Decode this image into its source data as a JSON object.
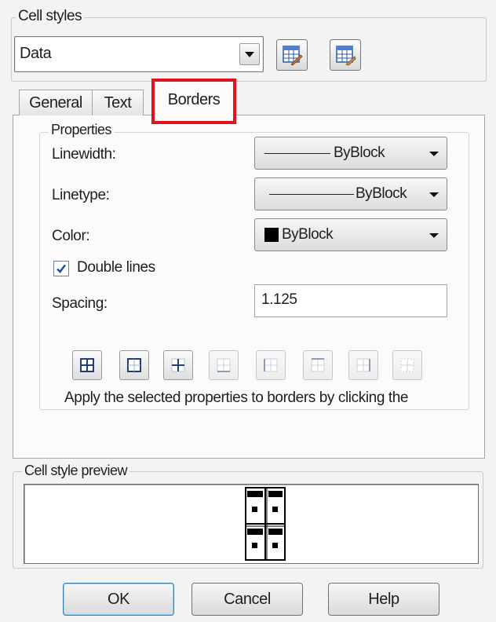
{
  "cell_styles": {
    "group_title": "Cell styles",
    "style_value": "Data",
    "launch_style_button_icon": "table-style-edit-icon",
    "manage_styles_button_icon": "cell-style-manage-icon"
  },
  "tabs": [
    {
      "label": "General",
      "active": false
    },
    {
      "label": "Text",
      "active": false
    },
    {
      "label": "Borders",
      "active": true
    }
  ],
  "properties": {
    "group_title": "Properties",
    "linewidth": {
      "label": "Linewidth:",
      "value": "ByBlock"
    },
    "linetype": {
      "label": "Linetype:",
      "value": "ByBlock"
    },
    "color": {
      "label": "Color:",
      "value": "ByBlock",
      "swatch": "#000000"
    },
    "double_lines": {
      "label": "Double lines",
      "checked": true
    },
    "spacing": {
      "label": "Spacing:",
      "value": "1.125"
    },
    "border_buttons": [
      {
        "name": "all-borders-icon",
        "enabled": true
      },
      {
        "name": "outside-borders-icon",
        "enabled": true
      },
      {
        "name": "inside-borders-icon",
        "enabled": true
      },
      {
        "name": "bottom-border-icon",
        "enabled": false
      },
      {
        "name": "left-border-icon",
        "enabled": false
      },
      {
        "name": "top-border-icon",
        "enabled": false
      },
      {
        "name": "right-border-icon",
        "enabled": false
      },
      {
        "name": "no-border-icon",
        "enabled": false
      }
    ],
    "hint": "Apply the selected properties to borders by clicking the"
  },
  "preview": {
    "group_title": "Cell style preview"
  },
  "buttons": {
    "ok": "OK",
    "cancel": "Cancel",
    "help": "Help"
  },
  "colors": {
    "highlight": "#e0141e",
    "default_button_border": "#3c7fb1",
    "checkmark": "#1a4b9c"
  }
}
